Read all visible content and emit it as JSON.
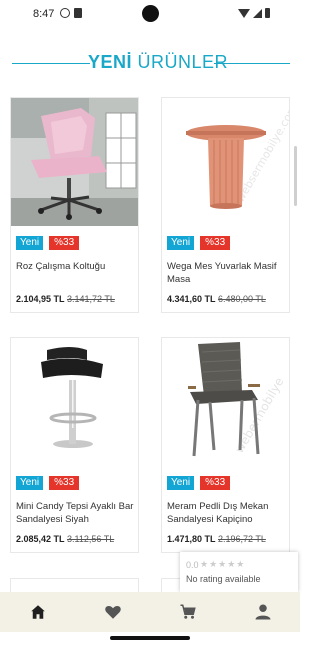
{
  "status_bar": {
    "time": "8:47"
  },
  "section": {
    "title_strong": "YENİ",
    "title_rest": " ÜRÜNLER"
  },
  "products": [
    {
      "name": "Roz Çalışma Koltuğu",
      "badge_new": "Yeni",
      "badge_discount": "%33",
      "price": "2.104,95 TL",
      "old_price": "3.141,72 TL"
    },
    {
      "name": "Wega Mes Yuvarlak Masif Masa",
      "badge_new": "Yeni",
      "badge_discount": "%33",
      "price": "4.341,60 TL",
      "old_price": "6.480,00 TL"
    },
    {
      "name": "Mini Candy Tepsi Ayaklı Bar Sandalyesi Siyah",
      "badge_new": "Yeni",
      "badge_discount": "%33",
      "price": "2.085,42 TL",
      "old_price": "3.112,56 TL"
    },
    {
      "name": "Meram Pedli Dış Mekan Sandalyesi Kapiçino",
      "badge_new": "Yeni",
      "badge_discount": "%33",
      "price": "1.471,80 TL",
      "old_price": "2.196,72 TL"
    }
  ],
  "rating_widget": {
    "score": "0.0",
    "stars": "★★★★★",
    "text": "No rating available"
  },
  "bottom_nav": {
    "items": [
      {
        "icon": "home-icon",
        "active": true
      },
      {
        "icon": "heart-icon",
        "active": false
      },
      {
        "icon": "cart-icon",
        "active": false
      },
      {
        "icon": "user-icon",
        "active": false
      }
    ]
  },
  "colors": {
    "accent": "#1aa8c8",
    "badge_new": "#13a6d4",
    "badge_discount": "#e5342a",
    "nav_bg": "#f3f1e6"
  }
}
